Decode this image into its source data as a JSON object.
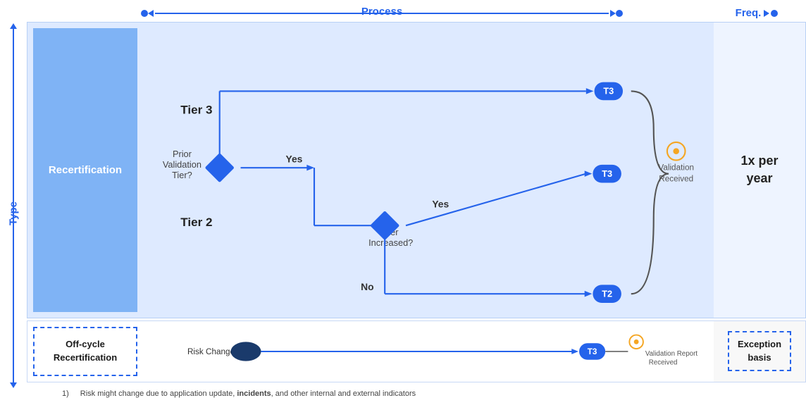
{
  "axes": {
    "process_label": "Process",
    "freq_label": "Freq.",
    "type_label": "Type"
  },
  "recertification": {
    "box_label": "Recertification",
    "tier3_label": "Tier 3",
    "tier2_label": "Tier 2",
    "prior_validation_label": "Prior\nValidation\nTier?",
    "yes_label": "Yes",
    "no_label": "No",
    "tier_increased_label": "Tier\nIncreased?",
    "badge_t3_1": "T3",
    "badge_t3_2": "T3",
    "badge_t2": "T2"
  },
  "offcycle": {
    "box_label": "Off-cycle\nRecertification",
    "risk_change_label": "Risk Change¹",
    "badge_t3": "T3",
    "validation_report_label": "Validation Report\nReceived"
  },
  "validation": {
    "received_label": "Validation\nReceived"
  },
  "freq": {
    "value": "1x per\nyear"
  },
  "exception": {
    "label": "Exception\nbasis"
  },
  "footnote": {
    "number": "1)",
    "text": "Risk might change due to application update, ",
    "bold": "incidents",
    "text2": ", and other internal and external indicators"
  }
}
